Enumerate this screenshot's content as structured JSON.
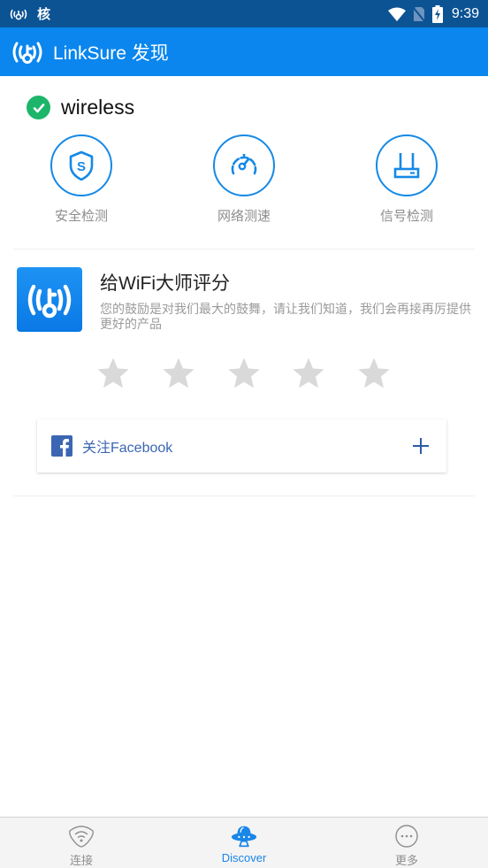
{
  "status_bar": {
    "carrier_label": "核",
    "time": "9:39",
    "icons": [
      "wifi-key-icon",
      "wifi-signal-icon",
      "no-sim-icon",
      "battery-charging-icon"
    ]
  },
  "app_bar": {
    "logo_icon": "wifi-key-logo-icon",
    "title": "LinkSure 发现"
  },
  "connection": {
    "status_icon": "check-circle-icon",
    "status_color": "#1db56a",
    "ssid": "wireless"
  },
  "tools": [
    {
      "label": "安全检测",
      "icon": "shield-s-icon"
    },
    {
      "label": "网络测速",
      "icon": "speedometer-icon"
    },
    {
      "label": "信号检测",
      "icon": "router-icon"
    }
  ],
  "rating": {
    "app_icon": "wifi-master-app-icon",
    "title": "给WiFi大师评分",
    "description": "您的鼓励是对我们最大的鼓舞，请让我们知道，我们会再接再厉提供更好的产品",
    "stars_total": 5,
    "stars_selected": 0,
    "star_color": "#d9d9d9"
  },
  "facebook": {
    "label": "关注Facebook",
    "icon": "facebook-icon",
    "action_icon": "plus-icon",
    "brand_color": "#3b66b3"
  },
  "bottom_nav": {
    "items": [
      {
        "label": "连接",
        "icon": "wifi-connect-icon",
        "active": false
      },
      {
        "label": "Discover",
        "icon": "ufo-icon",
        "active": true
      },
      {
        "label": "更多",
        "icon": "more-dots-icon",
        "active": false
      }
    ],
    "active_color": "#1a86e8"
  },
  "colors": {
    "status_bar": "#0c5394",
    "app_bar": "#0a86ee",
    "accent": "#1589e6"
  }
}
